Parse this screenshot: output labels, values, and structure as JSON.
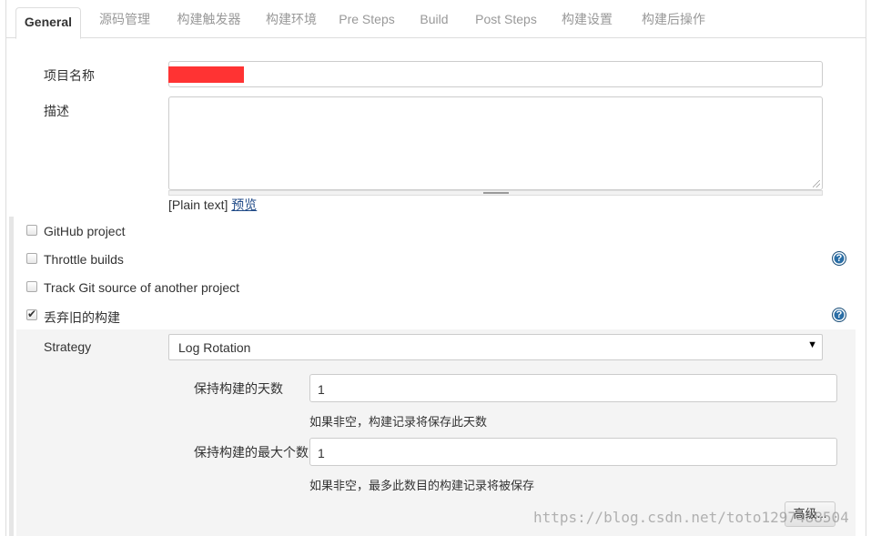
{
  "tabs": [
    {
      "label": "General",
      "active": true
    },
    {
      "label": "源码管理",
      "active": false
    },
    {
      "label": "构建触发器",
      "active": false
    },
    {
      "label": "构建环境",
      "active": false
    },
    {
      "label": "Pre Steps",
      "active": false
    },
    {
      "label": "Build",
      "active": false
    },
    {
      "label": "Post Steps",
      "active": false
    },
    {
      "label": "构建设置",
      "active": false
    },
    {
      "label": "构建后操作",
      "active": false
    }
  ],
  "general": {
    "project_name_label": "项目名称",
    "project_name_value": "",
    "description_label": "描述",
    "description_value": "",
    "plain_text": "[Plain text]",
    "preview_link": "预览"
  },
  "options": [
    {
      "label": "GitHub project",
      "checked": false,
      "help": false
    },
    {
      "label": "Throttle builds",
      "checked": false,
      "help": true
    },
    {
      "label": "Track Git source of another project",
      "checked": false,
      "help": false
    },
    {
      "label": "丢弃旧的构建",
      "checked": true,
      "help": true
    }
  ],
  "discard": {
    "strategy_label": "Strategy",
    "strategy_value": "Log Rotation",
    "days_label": "保持构建的天数",
    "days_value": "1",
    "days_hint": "如果非空，构建记录将保存此天数",
    "max_label": "保持构建的最大个数",
    "max_value": "1",
    "max_hint": "如果非空，最多此数目的构建记录将被保存",
    "advanced_button": "高级..."
  },
  "watermark": "https://blog.csdn.net/toto1297488504",
  "colors": {
    "redaction": "#ff3333",
    "help_icon": "#2a6ea6",
    "link": "#204a87"
  }
}
